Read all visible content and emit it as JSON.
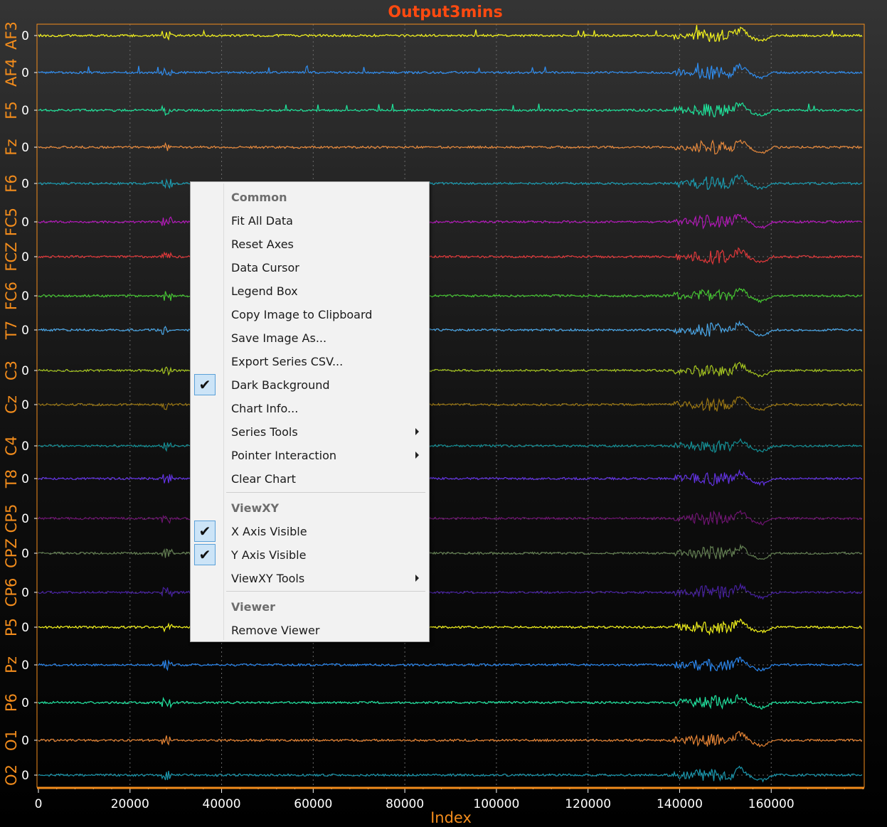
{
  "title": "Output3mins",
  "context_menu": {
    "common_header": "Common",
    "fit_all_data": "Fit All Data",
    "reset_axes": "Reset Axes",
    "data_cursor": "Data Cursor",
    "legend_box": "Legend Box",
    "copy_image": "Copy Image to Clipboard",
    "save_image": "Save Image As...",
    "export_csv": "Export Series CSV...",
    "dark_background": "Dark Background",
    "dark_background_checked": true,
    "chart_info": "Chart Info...",
    "series_tools": "Series Tools",
    "pointer_interaction": "Pointer Interaction",
    "clear_chart": "Clear Chart",
    "viewxy_header": "ViewXY",
    "x_axis_visible": "X Axis Visible",
    "x_axis_visible_checked": true,
    "y_axis_visible": "Y Axis Visible",
    "y_axis_visible_checked": true,
    "viewxy_tools": "ViewXY Tools",
    "viewer_header": "Viewer",
    "remove_viewer": "Remove Viewer",
    "check_glyph": "✔"
  },
  "chart_data": {
    "type": "line",
    "title": "Output3mins",
    "xlabel": "Index",
    "xlim": [
      0,
      180000
    ],
    "x_ticks": [
      "0",
      "20000",
      "40000",
      "60000",
      "80000",
      "100000",
      "120000",
      "140000",
      "160000"
    ],
    "y_tick_label": "0",
    "grid": true,
    "colors": {
      "axis_accent": "#f28c1c",
      "title": "#ff4a10",
      "background_top": "#3a3a3a",
      "background_bottom": "#000000"
    },
    "series": [
      {
        "name": "AF3",
        "color": "#f5f51b"
      },
      {
        "name": "AF4",
        "color": "#2f8df0"
      },
      {
        "name": "F5",
        "color": "#1ee39a"
      },
      {
        "name": "Fz",
        "color": "#e98a3c"
      },
      {
        "name": "F6",
        "color": "#1a9bb0"
      },
      {
        "name": "FC5",
        "color": "#b218b8"
      },
      {
        "name": "FCZ",
        "color": "#e0383a"
      },
      {
        "name": "FC6",
        "color": "#45c532"
      },
      {
        "name": "T7",
        "color": "#4aa7e8"
      },
      {
        "name": "C3",
        "color": "#a5c51f"
      },
      {
        "name": "Cz",
        "color": "#9a7612"
      },
      {
        "name": "C4",
        "color": "#138f95"
      },
      {
        "name": "T8",
        "color": "#6232e3"
      },
      {
        "name": "CP5",
        "color": "#6c136f"
      },
      {
        "name": "CPZ",
        "color": "#637f52"
      },
      {
        "name": "CP6",
        "color": "#46209e"
      },
      {
        "name": "P5",
        "color": "#f2f21a"
      },
      {
        "name": "Pz",
        "color": "#2a86ee"
      },
      {
        "name": "P6",
        "color": "#1fe5a0"
      },
      {
        "name": "O1",
        "color": "#e68434"
      },
      {
        "name": "O2",
        "color": "#1a97ad"
      }
    ]
  }
}
